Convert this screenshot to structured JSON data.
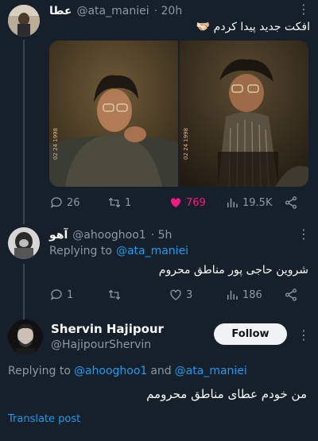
{
  "tweet1": {
    "display_name": "عطا",
    "handle": "@ata_maniei",
    "time": "· 20h",
    "text": "افکت جدید پیدا کردم 🫱🏻‍🫲🏼",
    "photo_stamp_left": "02 24 1998",
    "photo_stamp_right": "02 24 1998",
    "replies": "26",
    "retweets": "1",
    "likes": "769",
    "views": "19.5K"
  },
  "tweet2": {
    "display_name": "آهو",
    "handle": "@ahooghoo1",
    "time": "· 5h",
    "replying_label": "Replying to",
    "replying_to": "@ata_maniei",
    "text": "شروین حاجی پور مناطق محروم",
    "replies": "1",
    "likes": "3",
    "views": "186"
  },
  "tweet3": {
    "display_name": "Shervin Hajipour",
    "handle": "@HajipourShervin",
    "follow_label": "Follow",
    "replying_label": "Replying to",
    "replying_to_1": "@ahooghoo1",
    "and": "and",
    "replying_to_2": "@ata_maniei",
    "text": "من خودم عطای مناطق محرومم",
    "translate": "Translate post"
  },
  "colors": {
    "background": "#15202b",
    "accent": "#1d9bf0",
    "like": "#f91880",
    "muted": "#8b98a5"
  }
}
